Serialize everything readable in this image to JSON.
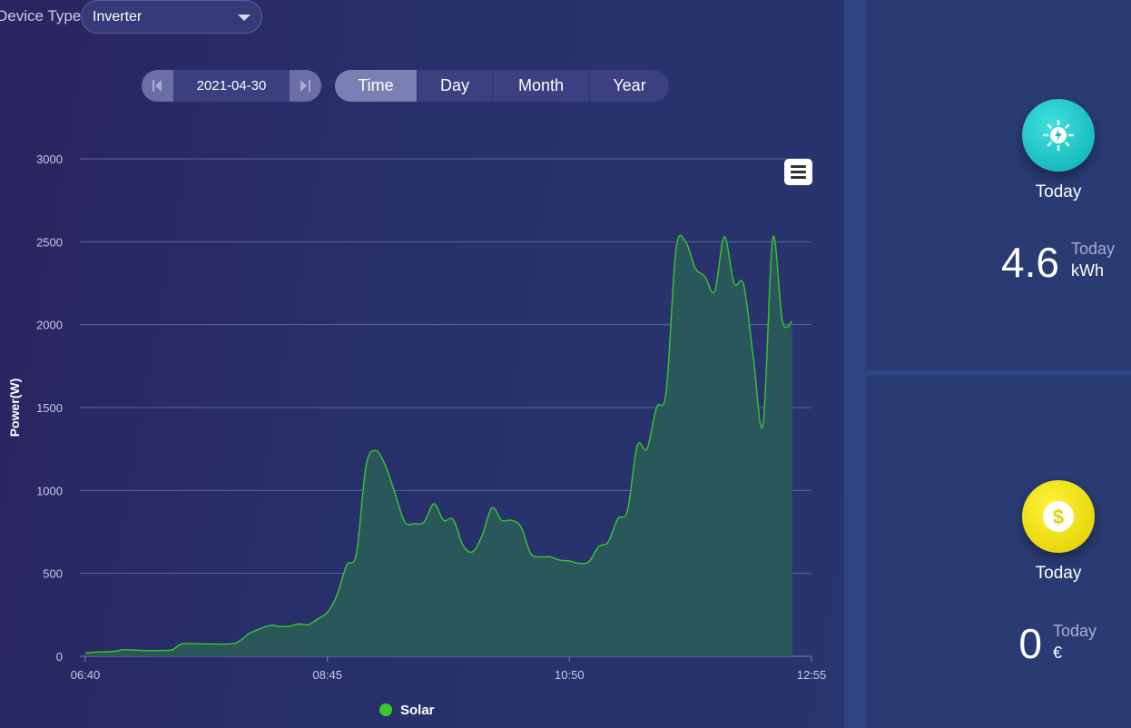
{
  "device": {
    "label": "Device Type",
    "selected": "Inverter"
  },
  "date_nav": {
    "date": "2021-04-30",
    "prev_icon": "skip-back-icon",
    "next_icon": "skip-forward-icon"
  },
  "period_tabs": [
    {
      "label": "Time",
      "active": true
    },
    {
      "label": "Day",
      "active": false
    },
    {
      "label": "Month",
      "active": false
    },
    {
      "label": "Year",
      "active": false
    }
  ],
  "chart_data": {
    "type": "area",
    "ylabel": "Power(W)",
    "ylim": [
      0,
      3000
    ],
    "yticks": [
      0,
      500,
      1000,
      1500,
      2000,
      2500,
      3000
    ],
    "xlim": [
      "06:40",
      "12:55"
    ],
    "xticks": [
      "06:40",
      "08:45",
      "10:50",
      "12:55"
    ],
    "grid": true,
    "legend_position": "bottom-center",
    "series": [
      {
        "name": "Solar",
        "color": "#39c72c",
        "fill": "#2a5a5a",
        "points": [
          [
            "06:40",
            20
          ],
          [
            "06:45",
            25
          ],
          [
            "06:55",
            30
          ],
          [
            "07:00",
            40
          ],
          [
            "07:10",
            35
          ],
          [
            "07:20",
            35
          ],
          [
            "07:25",
            40
          ],
          [
            "07:30",
            75
          ],
          [
            "07:40",
            75
          ],
          [
            "07:55",
            75
          ],
          [
            "08:00",
            95
          ],
          [
            "08:05",
            140
          ],
          [
            "08:15",
            185
          ],
          [
            "08:20",
            180
          ],
          [
            "08:25",
            180
          ],
          [
            "08:30",
            195
          ],
          [
            "08:35",
            190
          ],
          [
            "08:40",
            225
          ],
          [
            "08:45",
            265
          ],
          [
            "08:50",
            370
          ],
          [
            "08:55",
            550
          ],
          [
            "09:00",
            620
          ],
          [
            "09:05",
            1150
          ],
          [
            "09:10",
            1240
          ],
          [
            "09:15",
            1150
          ],
          [
            "09:20",
            980
          ],
          [
            "09:25",
            810
          ],
          [
            "09:30",
            800
          ],
          [
            "09:35",
            810
          ],
          [
            "09:40",
            920
          ],
          [
            "09:45",
            820
          ],
          [
            "09:50",
            825
          ],
          [
            "09:55",
            670
          ],
          [
            "10:00",
            630
          ],
          [
            "10:05",
            730
          ],
          [
            "10:10",
            895
          ],
          [
            "10:15",
            820
          ],
          [
            "10:20",
            820
          ],
          [
            "10:25",
            780
          ],
          [
            "10:30",
            620
          ],
          [
            "10:35",
            600
          ],
          [
            "10:40",
            600
          ],
          [
            "10:45",
            580
          ],
          [
            "10:50",
            575
          ],
          [
            "10:55",
            560
          ],
          [
            "11:00",
            570
          ],
          [
            "11:05",
            660
          ],
          [
            "11:10",
            690
          ],
          [
            "11:15",
            830
          ],
          [
            "11:20",
            880
          ],
          [
            "11:25",
            1270
          ],
          [
            "11:30",
            1250
          ],
          [
            "11:35",
            1500
          ],
          [
            "11:40",
            1600
          ],
          [
            "11:45",
            2450
          ],
          [
            "11:50",
            2500
          ],
          [
            "11:55",
            2340
          ],
          [
            "12:00",
            2290
          ],
          [
            "12:05",
            2200
          ],
          [
            "12:10",
            2530
          ],
          [
            "12:15",
            2250
          ],
          [
            "12:20",
            2240
          ],
          [
            "12:25",
            1800
          ],
          [
            "12:30",
            1400
          ],
          [
            "12:35",
            2520
          ],
          [
            "12:40",
            2020
          ],
          [
            "12:45",
            2020
          ]
        ]
      }
    ]
  },
  "chart_menu": {
    "icon": "hamburger-menu-icon"
  },
  "energy_card": {
    "icon": "solar-sun-icon",
    "label": "Today",
    "value": "4.6",
    "sub_label": "Today",
    "unit": "kWh",
    "accent": "#1fc6c8"
  },
  "earnings_card": {
    "icon": "dollar-coin-icon",
    "label": "Today",
    "value": "0",
    "sub_label": "Today",
    "unit": "€",
    "accent": "#f0e11a"
  }
}
